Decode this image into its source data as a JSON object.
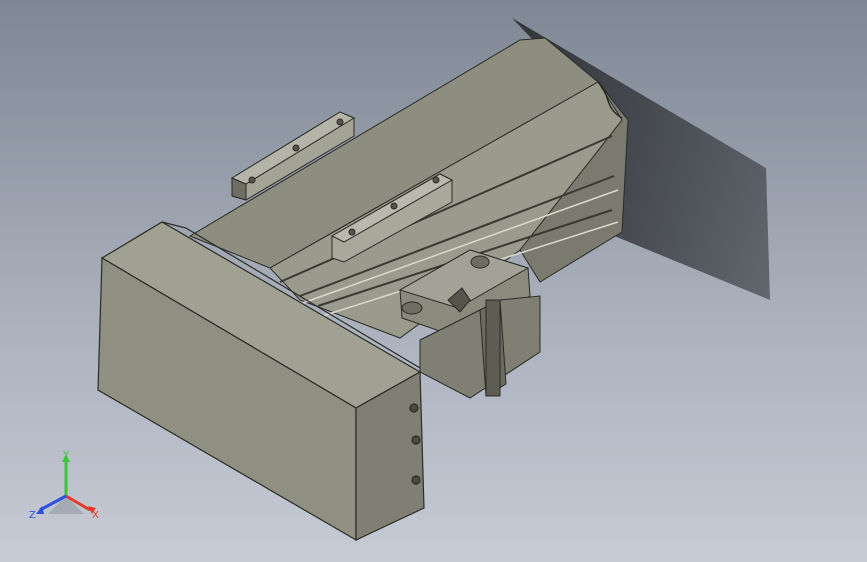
{
  "viewport": {
    "background_top": "#7f8794",
    "background_bottom": "#c6cbd5"
  },
  "model": {
    "body_color": "#8b8b7e",
    "edge_color": "#2b2b27",
    "shadow_color": "#1d1f22"
  },
  "triad": {
    "x_label": "X",
    "y_label": "Y",
    "z_label": "Z",
    "x_color": "#e53a2a",
    "y_color": "#3cc43a",
    "z_color": "#2f4fe0"
  }
}
